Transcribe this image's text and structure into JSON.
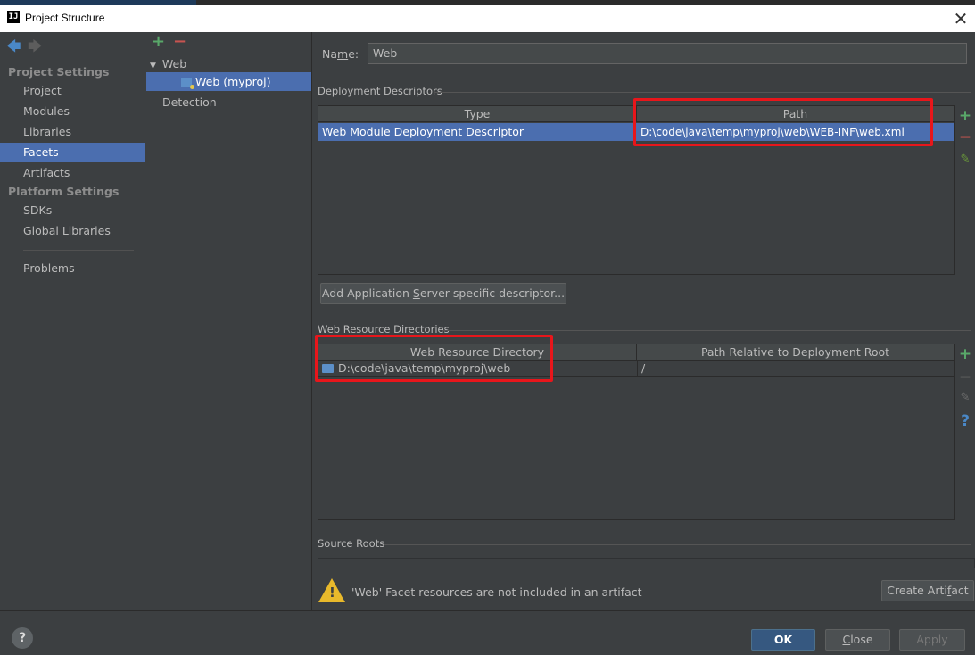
{
  "window": {
    "title": "Project Structure",
    "app_icon": "IJ",
    "close": "✕"
  },
  "nav": {
    "back_icon": "arrow-left-icon",
    "forward_icon": "arrow-right-icon"
  },
  "sidebar": {
    "project_settings": "Project Settings",
    "items": [
      "Project",
      "Modules",
      "Libraries",
      "Facets",
      "Artifacts"
    ],
    "platform_settings": "Platform Settings",
    "platform_items": [
      "SDKs",
      "Global Libraries"
    ],
    "problems": "Problems",
    "selected": "Facets"
  },
  "tree": {
    "add": "+",
    "remove": "−",
    "root": "Web",
    "child": "Web (myproj)",
    "detection": "Detection"
  },
  "main": {
    "name_label_pre": "Na",
    "name_label_u": "m",
    "name_label_post": "e:",
    "name_value": "Web",
    "deployment": {
      "title": "Deployment Descriptors",
      "columns": [
        "Type",
        "Path"
      ],
      "rows": [
        {
          "type": "Web Module Deployment Descriptor",
          "path": "D:\\code\\java\\temp\\myproj\\web\\WEB-INF\\web.xml"
        }
      ],
      "add_button_pre": "Add Application ",
      "add_button_u": "S",
      "add_button_post": "erver specific descriptor..."
    },
    "resources": {
      "title": "Web Resource Directories",
      "columns": [
        "Web Resource Directory",
        "Path Relative to Deployment Root"
      ],
      "rows": [
        {
          "dir": "D:\\code\\java\\temp\\myproj\\web",
          "relative": "/"
        }
      ]
    },
    "source_roots": {
      "title": "Source Roots"
    },
    "warning": {
      "text": "'Web' Facet resources are not included in an artifact",
      "button_pre": "Create Arti",
      "button_u": "f",
      "button_post": "act"
    }
  },
  "footer": {
    "help": "?",
    "ok": "OK",
    "cancel_u": "C",
    "cancel_rest": "lose",
    "apply": "Apply"
  },
  "colors": {
    "selection": "#4b6eaf",
    "highlight_box": "#e8161b",
    "add": "#59a869",
    "remove": "#c75450"
  }
}
